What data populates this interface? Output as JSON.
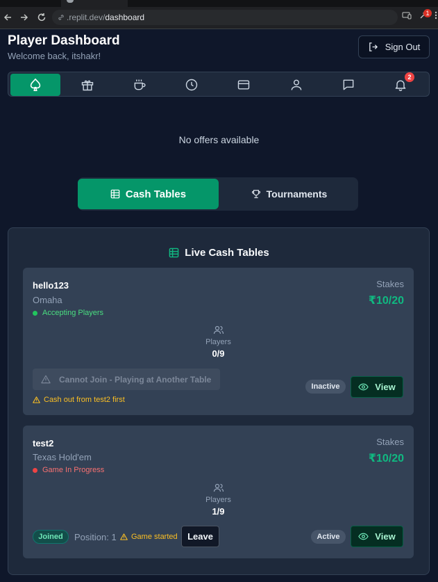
{
  "browser": {
    "url_host": ".replit.dev/",
    "url_path": "dashboard",
    "extension_badge": "1"
  },
  "header": {
    "title": "Player Dashboard",
    "welcome": "Welcome back, itshakr!",
    "sign_out_label": "Sign Out"
  },
  "nav": {
    "items": [
      "spade-icon",
      "gift-icon",
      "coffee-icon",
      "clock-icon",
      "credit-card-icon",
      "user-icon",
      "message-icon",
      "bell-icon"
    ],
    "active_index": 0,
    "notification_count": "2"
  },
  "offers": {
    "empty_text": "No offers available"
  },
  "segment": {
    "cash_tables_label": "Cash Tables",
    "tournaments_label": "Tournaments",
    "active": "Cash Tables"
  },
  "live_tables": {
    "title": "Live Cash Tables",
    "stakes_label": "Stakes",
    "players_label": "Players",
    "view_label": "View",
    "tables": [
      {
        "name": "hello123",
        "game": "Omaha",
        "status": "Accepting Players",
        "status_color": "#22c55e",
        "stakes": "₹10/20",
        "players": "0/9",
        "join_label": "Cannot Join - Playing at Another Table",
        "warning": "Cash out from test2 first",
        "state": "Inactive"
      },
      {
        "name": "test2",
        "game": "Texas Hold'em",
        "status": "Game In Progress",
        "status_color": "#ef4444",
        "stakes": "₹10/20",
        "players": "1/9",
        "joined_label": "Joined",
        "position_label": "Position: 1",
        "game_started_label": "Game started",
        "leave_label": "Leave",
        "state": "Active"
      }
    ]
  },
  "colors": {
    "accent": "#059669",
    "background": "#0f172a",
    "card": "#334155",
    "warning": "#fbbf24"
  }
}
